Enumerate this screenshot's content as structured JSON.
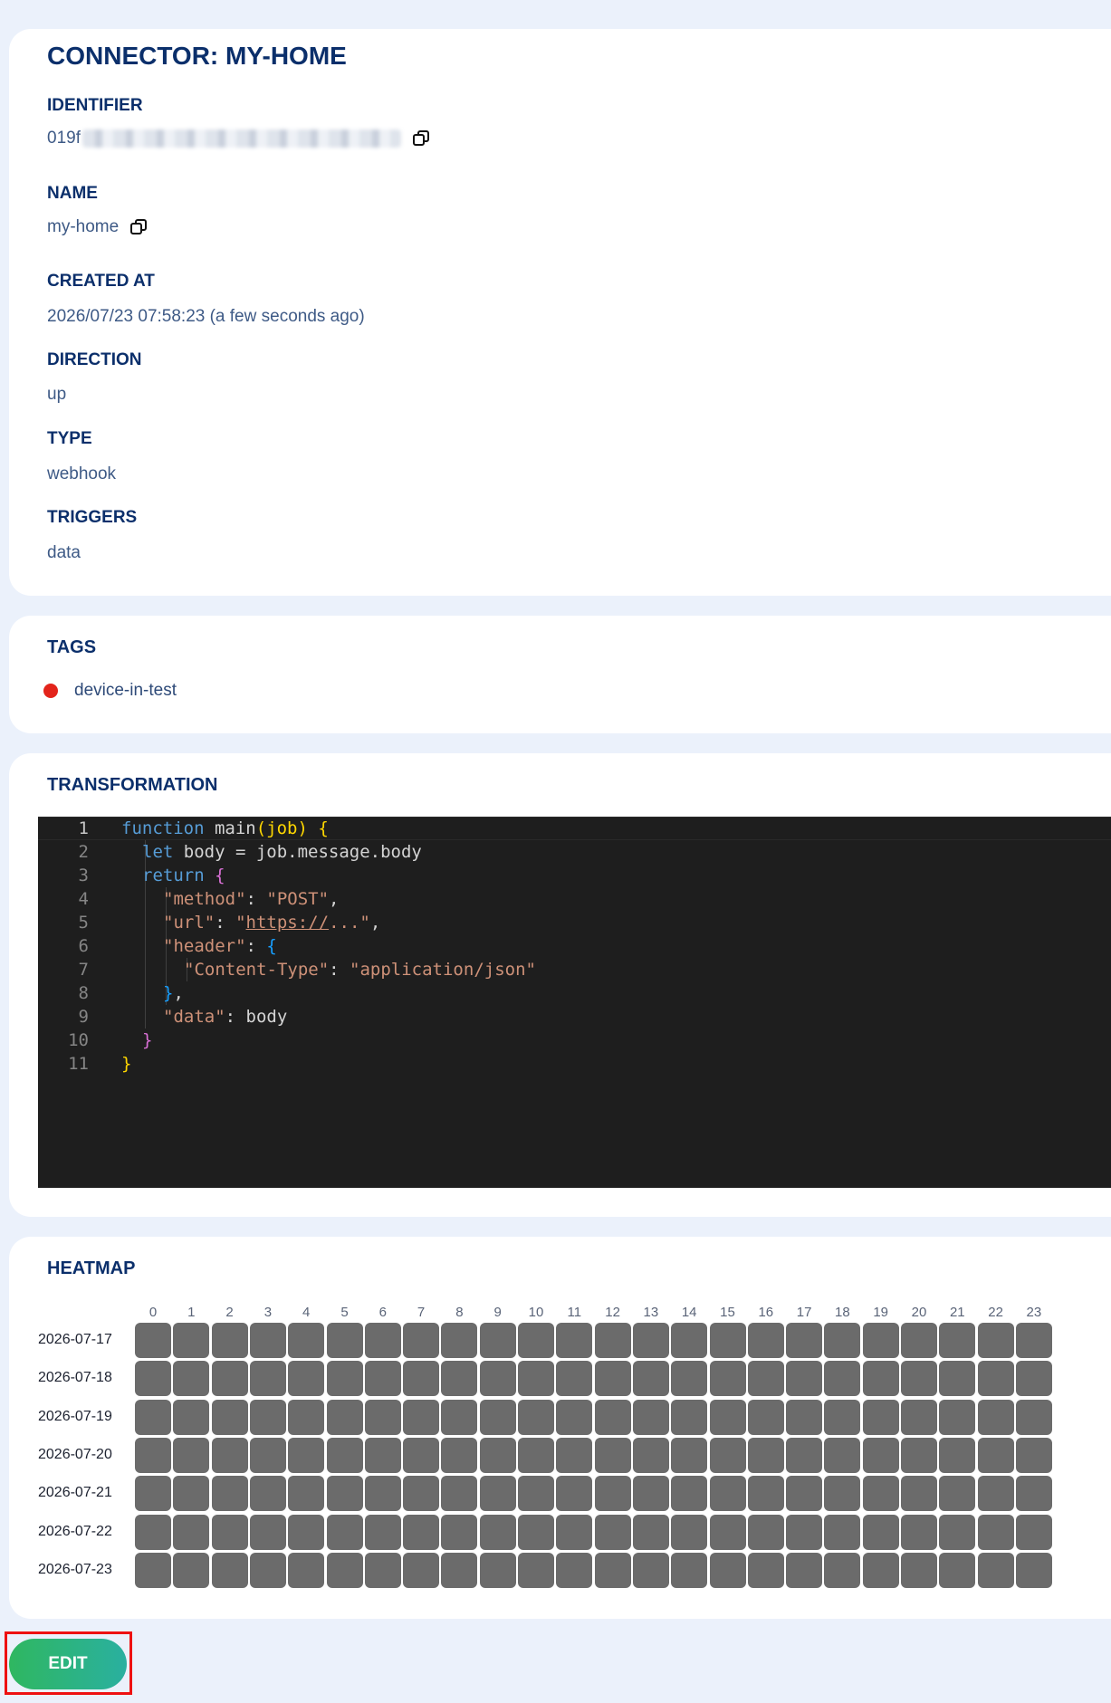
{
  "details": {
    "title": "CONNECTOR: MY-HOME",
    "identifier_label": "IDENTIFIER",
    "identifier_value": "019f",
    "name_label": "NAME",
    "name_value": "my-home",
    "created_label": "CREATED AT",
    "created_value": "2026/07/23 07:58:23 (a few seconds ago)",
    "direction_label": "DIRECTION",
    "direction_value": "up",
    "type_label": "TYPE",
    "type_value": "webhook",
    "triggers_label": "TRIGGERS",
    "triggers_value": "data"
  },
  "tags": {
    "title": "TAGS",
    "items": [
      {
        "name": "device-in-test",
        "color": "#e3241b"
      }
    ]
  },
  "transformation": {
    "title": "TRANSFORMATION",
    "line_numbers": [
      "1",
      "2",
      "3",
      "4",
      "5",
      "6",
      "7",
      "8",
      "9",
      "10",
      "11"
    ],
    "code": {
      "l1_kw": "function",
      "l1_rest": " main",
      "l1_p": "(job)",
      "l1_b": " {",
      "l2_kw": "let",
      "l2_rest": " body = job.message.body",
      "l3_kw": "return",
      "l3_b": " {",
      "l4_key": "\"method\"",
      "l4_sep": ": ",
      "l4_val": "\"POST\"",
      "l4_end": ",",
      "l5_key": "\"url\"",
      "l5_sep": ": ",
      "l5_q1": "\"",
      "l5_url": "https://",
      "l5_val": "...\"",
      "l5_end": ",",
      "l6_key": "\"header\"",
      "l6_sep": ": ",
      "l6_b": "{",
      "l7_key": "\"Content-Type\"",
      "l7_sep": ": ",
      "l7_val": "\"application/json\"",
      "l8_b": "}",
      "l8_end": ",",
      "l9_key": "\"data\"",
      "l9_sep": ": ",
      "l9_val": "body",
      "l10_b": "}",
      "l11_b": "}"
    }
  },
  "heatmap": {
    "title": "HEATMAP",
    "cell_color": "#6b6b6b",
    "hours": [
      "0",
      "1",
      "2",
      "3",
      "4",
      "5",
      "6",
      "7",
      "8",
      "9",
      "10",
      "11",
      "12",
      "13",
      "14",
      "15",
      "16",
      "17",
      "18",
      "19",
      "20",
      "21",
      "22",
      "23"
    ],
    "dates": [
      "2026-07-17",
      "2026-07-18",
      "2026-07-19",
      "2026-07-20",
      "2026-07-21",
      "2026-07-22",
      "2026-07-23"
    ]
  },
  "actions": {
    "edit_label": "EDIT",
    "edit_gradient_start": "#2fb760",
    "edit_gradient_end": "#2ab0a0"
  }
}
